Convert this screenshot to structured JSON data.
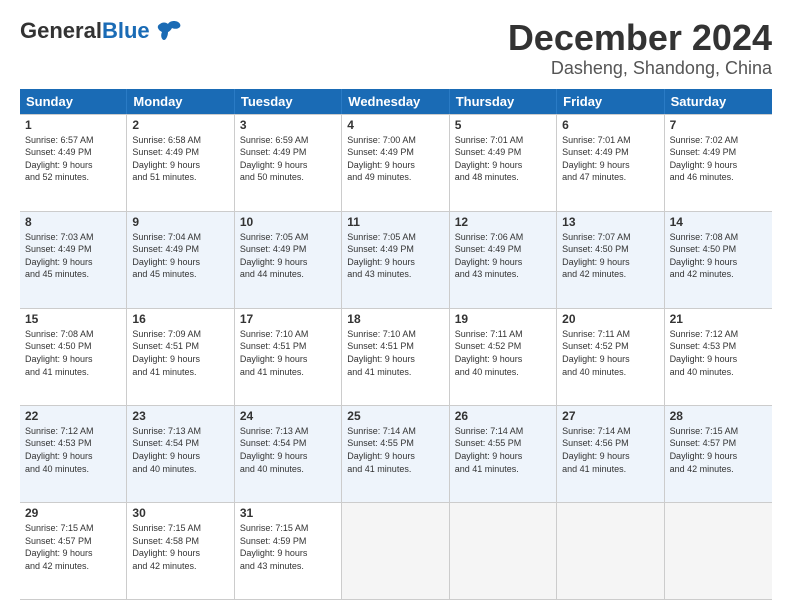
{
  "header": {
    "logo_general": "General",
    "logo_blue": "Blue",
    "title": "December 2024",
    "subtitle": "Dasheng, Shandong, China"
  },
  "calendar": {
    "days_of_week": [
      "Sunday",
      "Monday",
      "Tuesday",
      "Wednesday",
      "Thursday",
      "Friday",
      "Saturday"
    ],
    "weeks": [
      [
        {
          "day": "",
          "info": "",
          "empty": true
        },
        {
          "day": "",
          "info": "",
          "empty": true
        },
        {
          "day": "",
          "info": "",
          "empty": true
        },
        {
          "day": "",
          "info": "",
          "empty": true
        },
        {
          "day": "",
          "info": "",
          "empty": true
        },
        {
          "day": "",
          "info": "",
          "empty": true
        },
        {
          "day": "",
          "info": "",
          "empty": true
        }
      ],
      [
        {
          "day": "1",
          "info": "Sunrise: 6:57 AM\nSunset: 4:49 PM\nDaylight: 9 hours\nand 52 minutes."
        },
        {
          "day": "2",
          "info": "Sunrise: 6:58 AM\nSunset: 4:49 PM\nDaylight: 9 hours\nand 51 minutes."
        },
        {
          "day": "3",
          "info": "Sunrise: 6:59 AM\nSunset: 4:49 PM\nDaylight: 9 hours\nand 50 minutes."
        },
        {
          "day": "4",
          "info": "Sunrise: 7:00 AM\nSunset: 4:49 PM\nDaylight: 9 hours\nand 49 minutes."
        },
        {
          "day": "5",
          "info": "Sunrise: 7:01 AM\nSunset: 4:49 PM\nDaylight: 9 hours\nand 48 minutes."
        },
        {
          "day": "6",
          "info": "Sunrise: 7:01 AM\nSunset: 4:49 PM\nDaylight: 9 hours\nand 47 minutes."
        },
        {
          "day": "7",
          "info": "Sunrise: 7:02 AM\nSunset: 4:49 PM\nDaylight: 9 hours\nand 46 minutes."
        }
      ],
      [
        {
          "day": "8",
          "info": "Sunrise: 7:03 AM\nSunset: 4:49 PM\nDaylight: 9 hours\nand 45 minutes."
        },
        {
          "day": "9",
          "info": "Sunrise: 7:04 AM\nSunset: 4:49 PM\nDaylight: 9 hours\nand 45 minutes."
        },
        {
          "day": "10",
          "info": "Sunrise: 7:05 AM\nSunset: 4:49 PM\nDaylight: 9 hours\nand 44 minutes."
        },
        {
          "day": "11",
          "info": "Sunrise: 7:05 AM\nSunset: 4:49 PM\nDaylight: 9 hours\nand 43 minutes."
        },
        {
          "day": "12",
          "info": "Sunrise: 7:06 AM\nSunset: 4:49 PM\nDaylight: 9 hours\nand 43 minutes."
        },
        {
          "day": "13",
          "info": "Sunrise: 7:07 AM\nSunset: 4:50 PM\nDaylight: 9 hours\nand 42 minutes."
        },
        {
          "day": "14",
          "info": "Sunrise: 7:08 AM\nSunset: 4:50 PM\nDaylight: 9 hours\nand 42 minutes."
        }
      ],
      [
        {
          "day": "15",
          "info": "Sunrise: 7:08 AM\nSunset: 4:50 PM\nDaylight: 9 hours\nand 41 minutes."
        },
        {
          "day": "16",
          "info": "Sunrise: 7:09 AM\nSunset: 4:51 PM\nDaylight: 9 hours\nand 41 minutes."
        },
        {
          "day": "17",
          "info": "Sunrise: 7:10 AM\nSunset: 4:51 PM\nDaylight: 9 hours\nand 41 minutes."
        },
        {
          "day": "18",
          "info": "Sunrise: 7:10 AM\nSunset: 4:51 PM\nDaylight: 9 hours\nand 41 minutes."
        },
        {
          "day": "19",
          "info": "Sunrise: 7:11 AM\nSunset: 4:52 PM\nDaylight: 9 hours\nand 40 minutes."
        },
        {
          "day": "20",
          "info": "Sunrise: 7:11 AM\nSunset: 4:52 PM\nDaylight: 9 hours\nand 40 minutes."
        },
        {
          "day": "21",
          "info": "Sunrise: 7:12 AM\nSunset: 4:53 PM\nDaylight: 9 hours\nand 40 minutes."
        }
      ],
      [
        {
          "day": "22",
          "info": "Sunrise: 7:12 AM\nSunset: 4:53 PM\nDaylight: 9 hours\nand 40 minutes."
        },
        {
          "day": "23",
          "info": "Sunrise: 7:13 AM\nSunset: 4:54 PM\nDaylight: 9 hours\nand 40 minutes."
        },
        {
          "day": "24",
          "info": "Sunrise: 7:13 AM\nSunset: 4:54 PM\nDaylight: 9 hours\nand 40 minutes."
        },
        {
          "day": "25",
          "info": "Sunrise: 7:14 AM\nSunset: 4:55 PM\nDaylight: 9 hours\nand 41 minutes."
        },
        {
          "day": "26",
          "info": "Sunrise: 7:14 AM\nSunset: 4:55 PM\nDaylight: 9 hours\nand 41 minutes."
        },
        {
          "day": "27",
          "info": "Sunrise: 7:14 AM\nSunset: 4:56 PM\nDaylight: 9 hours\nand 41 minutes."
        },
        {
          "day": "28",
          "info": "Sunrise: 7:15 AM\nSunset: 4:57 PM\nDaylight: 9 hours\nand 42 minutes."
        }
      ],
      [
        {
          "day": "29",
          "info": "Sunrise: 7:15 AM\nSunset: 4:57 PM\nDaylight: 9 hours\nand 42 minutes."
        },
        {
          "day": "30",
          "info": "Sunrise: 7:15 AM\nSunset: 4:58 PM\nDaylight: 9 hours\nand 42 minutes."
        },
        {
          "day": "31",
          "info": "Sunrise: 7:15 AM\nSunset: 4:59 PM\nDaylight: 9 hours\nand 43 minutes."
        },
        {
          "day": "",
          "info": "",
          "empty": true
        },
        {
          "day": "",
          "info": "",
          "empty": true
        },
        {
          "day": "",
          "info": "",
          "empty": true
        },
        {
          "day": "",
          "info": "",
          "empty": true
        }
      ]
    ]
  }
}
